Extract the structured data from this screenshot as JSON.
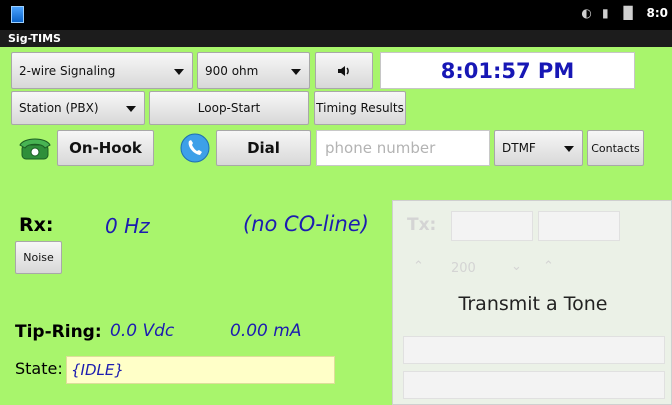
{
  "statusbar": {
    "time": "8:0",
    "icons": [
      "sync-icon",
      "usb-icon",
      "signal-icon"
    ]
  },
  "app": {
    "title": "Sig-TIMS"
  },
  "row1": {
    "mode_select": "2-wire Signaling",
    "impedance_select": "900 ohm",
    "volume_icon": "speaker-icon",
    "clock": "8:01:57 PM"
  },
  "row2": {
    "station_select": "Station (PBX)",
    "loop_button": "Loop-Start",
    "timing_button": "Timing Results"
  },
  "row3": {
    "hook_button": "On-Hook",
    "dial_button": "Dial",
    "phone_placeholder": "phone number",
    "dial_mode_select": "DTMF",
    "contacts_button": "Contacts"
  },
  "rx": {
    "label": "Rx:",
    "freq": "0 Hz",
    "coline": "(no CO-line)",
    "noise_button": "Noise"
  },
  "tip_ring": {
    "label": "Tip-Ring:",
    "voltage": "0.0 Vdc",
    "current": "0.00 mA"
  },
  "state": {
    "label": "State:",
    "value": "{IDLE}"
  },
  "tx_panel": {
    "label": "Transmit a Tone",
    "tx_label": "Tx:",
    "value": "200"
  },
  "colors": {
    "background": "#a8f56c",
    "clock_text": "#1717b5",
    "state_bg": "#ffffc8"
  }
}
